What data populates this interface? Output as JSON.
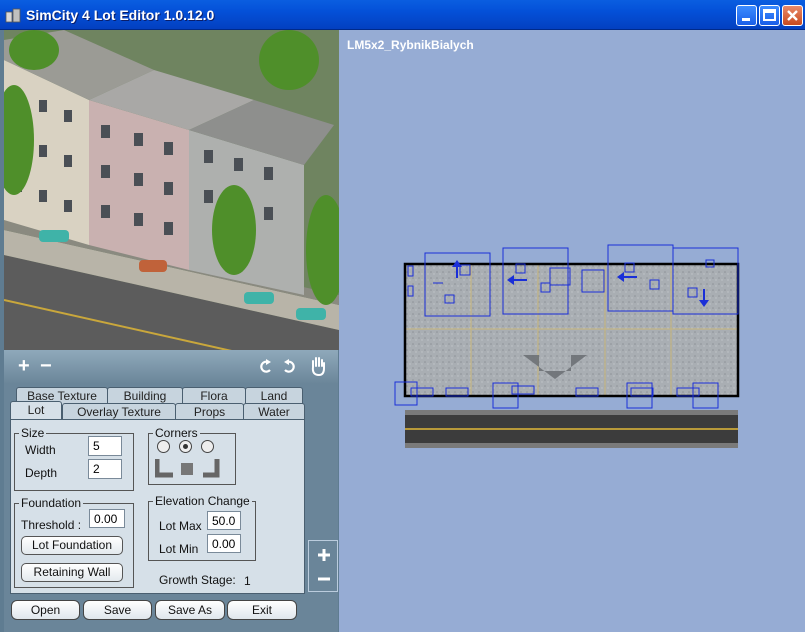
{
  "window": {
    "title": "SimCity 4 Lot Editor 1.0.12.0"
  },
  "colors": {
    "title_bar": "#0450d8",
    "panel": "#6a8599",
    "lot_bg": "#96acd4",
    "overlay_blue": "#1a2fd8"
  },
  "tabs_row1": [
    "Base Texture",
    "Building",
    "Flora",
    "Land"
  ],
  "tabs_row2": [
    "Lot",
    "Overlay Texture",
    "Props",
    "Water"
  ],
  "active_tab": "Lot",
  "size": {
    "label": "Size",
    "width_label": "Width",
    "width_value": "5",
    "depth_label": "Depth",
    "depth_value": "2"
  },
  "corners": {
    "label": "Corners",
    "selected": 2
  },
  "foundation": {
    "label": "Foundation",
    "threshold_label": "Threshold :",
    "threshold_value": "0.00",
    "lot_foundation_btn": "Lot Foundation",
    "retaining_wall_btn": "Retaining Wall"
  },
  "elevation": {
    "label": "Elevation Change",
    "lot_max_label": "Lot Max",
    "lot_max_value": "50.0",
    "lot_min_label": "Lot Min",
    "lot_min_value": "0.00"
  },
  "growth": {
    "label": "Growth Stage:",
    "value": "1"
  },
  "buttons": {
    "open": "Open",
    "save": "Save",
    "save_as": "Save As",
    "exit": "Exit"
  },
  "view_toolbar": {
    "zoom_in": "+",
    "zoom_out": "−"
  },
  "lot_view": {
    "lot_name": "LM5x2_RybnikBialych"
  },
  "icons": [
    "app-icon",
    "minimize-icon",
    "maximize-icon",
    "close-icon",
    "rotate-left-icon",
    "rotate-right-icon",
    "hand-pan-icon",
    "zoom-in-icon",
    "zoom-out-icon"
  ]
}
